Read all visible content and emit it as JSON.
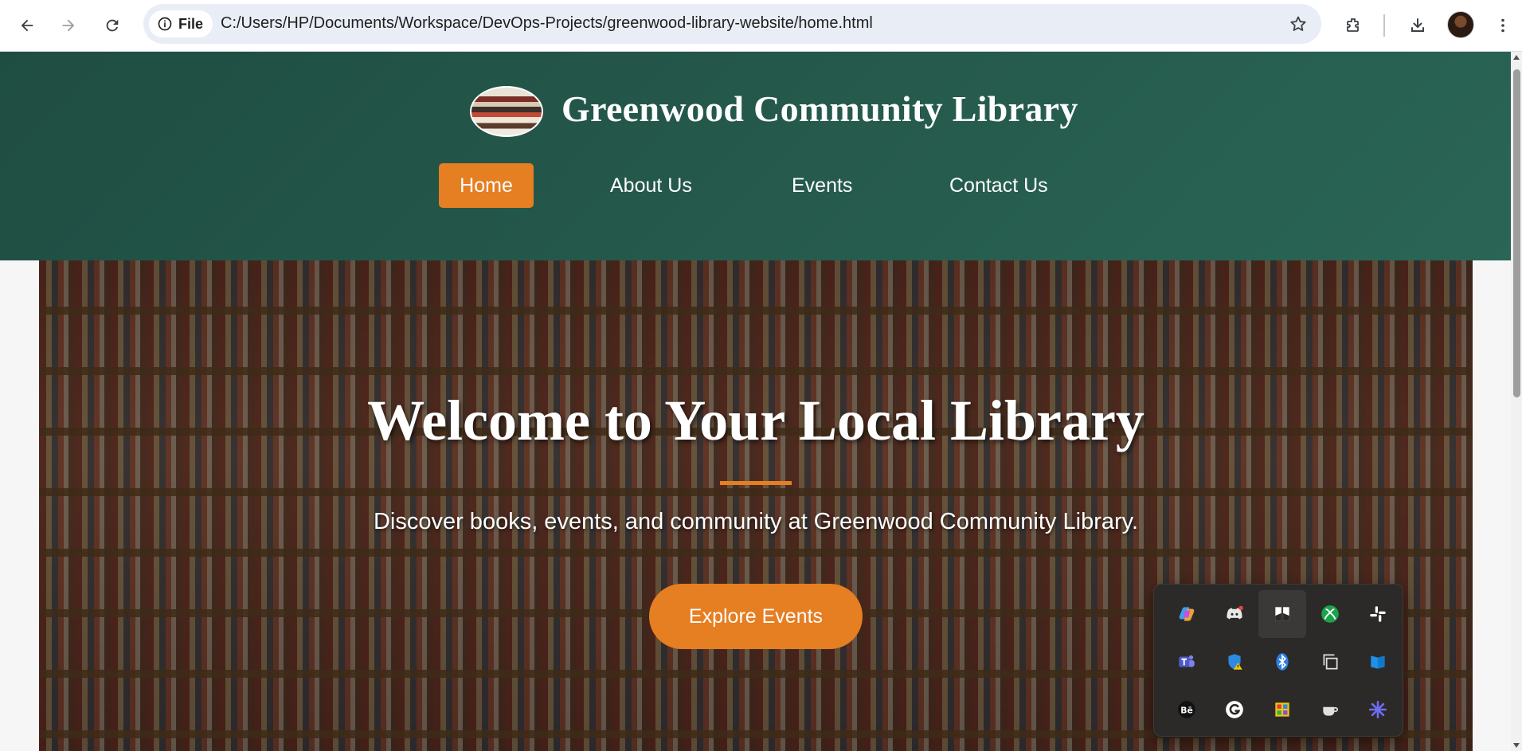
{
  "browser": {
    "file_label": "File",
    "url": "C:/Users/HP/Documents/Workspace/DevOps-Projects/greenwood-library-website/home.html",
    "icons": [
      "back-icon",
      "forward-icon",
      "reload-icon",
      "info-icon",
      "star-icon",
      "extensions-icon",
      "download-icon",
      "profile-avatar",
      "more-vert-icon"
    ]
  },
  "site": {
    "title": "Greenwood Community Library",
    "nav": [
      {
        "label": "Home",
        "active": true
      },
      {
        "label": "About Us",
        "active": false
      },
      {
        "label": "Events",
        "active": false
      },
      {
        "label": "Contact Us",
        "active": false
      }
    ]
  },
  "hero": {
    "title": "Welcome to Your Local Library",
    "subtitle": "Discover books, events, and community at Greenwood Community Library.",
    "cta_label": "Explore Events"
  },
  "colors": {
    "header_bg": "#1f4d42",
    "accent": "#e67e22",
    "tray_bg": "#2c2a28"
  },
  "tray": {
    "icons": [
      "copilot-icon",
      "discord-icon",
      "notion-icon",
      "xbox-icon",
      "slack-icon",
      "teams-icon",
      "defender-warning-icon",
      "bluetooth-icon",
      "copy-windows-icon",
      "onedrive-icon",
      "behance-icon",
      "grammarly-icon",
      "color-picker-icon",
      "coffee-cup-icon",
      "sparkle-icon"
    ]
  }
}
